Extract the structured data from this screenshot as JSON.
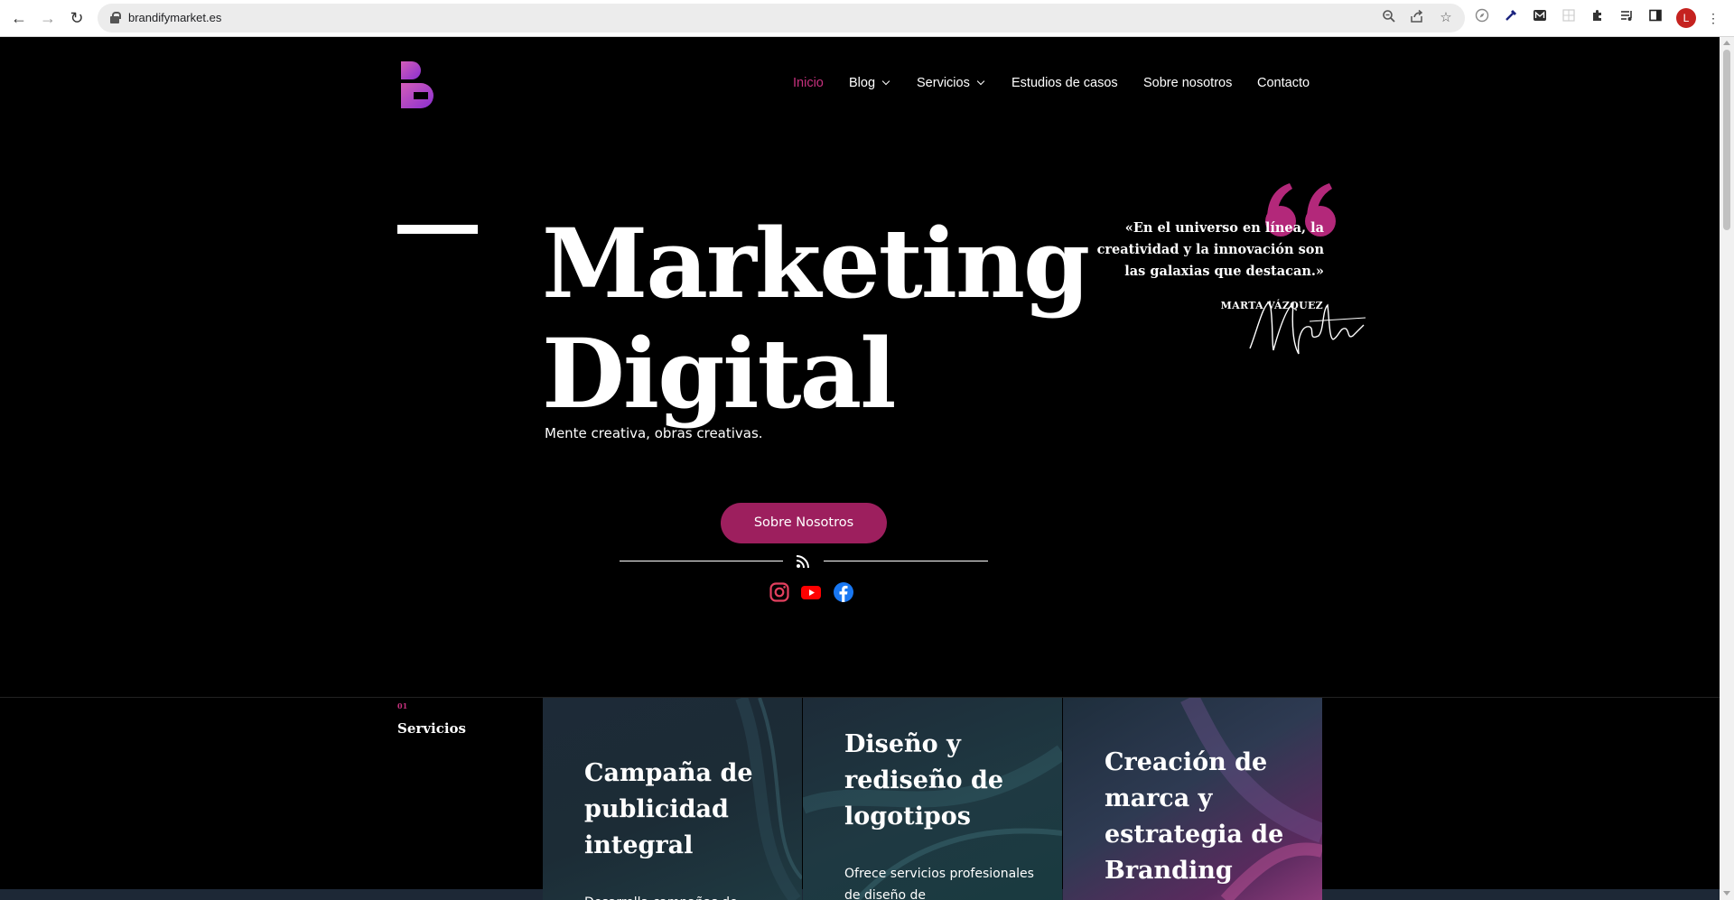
{
  "browser": {
    "url": "brandifymarket.es",
    "profile_initial": "L",
    "icons": [
      "back-icon",
      "forward-icon",
      "reload-icon",
      "lock-icon",
      "zoom-icon",
      "share-icon",
      "star-icon",
      "compass-extension-icon",
      "eyedropper-extension-icon",
      "m-extension-icon",
      "grid-extension-icon",
      "puzzle-extension-icon",
      "media-icon",
      "sidepanel-icon",
      "menu-icon"
    ]
  },
  "nav": {
    "items": [
      {
        "label": "Inicio"
      },
      {
        "label": "Blog"
      },
      {
        "label": "Servicios"
      },
      {
        "label": "Estudios de casos"
      },
      {
        "label": "Sobre nosotros"
      },
      {
        "label": "Contacto"
      }
    ],
    "active_color": "#c7317e"
  },
  "hero": {
    "title_line1": "Marketing",
    "title_line2": "Digital",
    "subtitle": "Mente creativa, obras creativas.",
    "quote": "«En el universo en línea, la creatividad y la innovación son las galaxias que destacan.»",
    "quote_author": "MARTA VÁZQUEZ",
    "signature_text": "Marta",
    "cta_label": "Sobre Nosotros",
    "cta_color": "#9d1f5e"
  },
  "social": [
    "instagram-icon",
    "youtube-icon",
    "facebook-icon"
  ],
  "services": {
    "section_number": "01",
    "section_title": "Servicios",
    "cards": [
      {
        "title": "Campaña de publicidad integral",
        "desc": "Desarrolla campañas de"
      },
      {
        "title": "Diseño y rediseño de logotipos",
        "desc": "Ofrece servicios profesionales de diseño de"
      },
      {
        "title": "Creación de marca y estrategia de Branding",
        "desc": ""
      }
    ]
  }
}
